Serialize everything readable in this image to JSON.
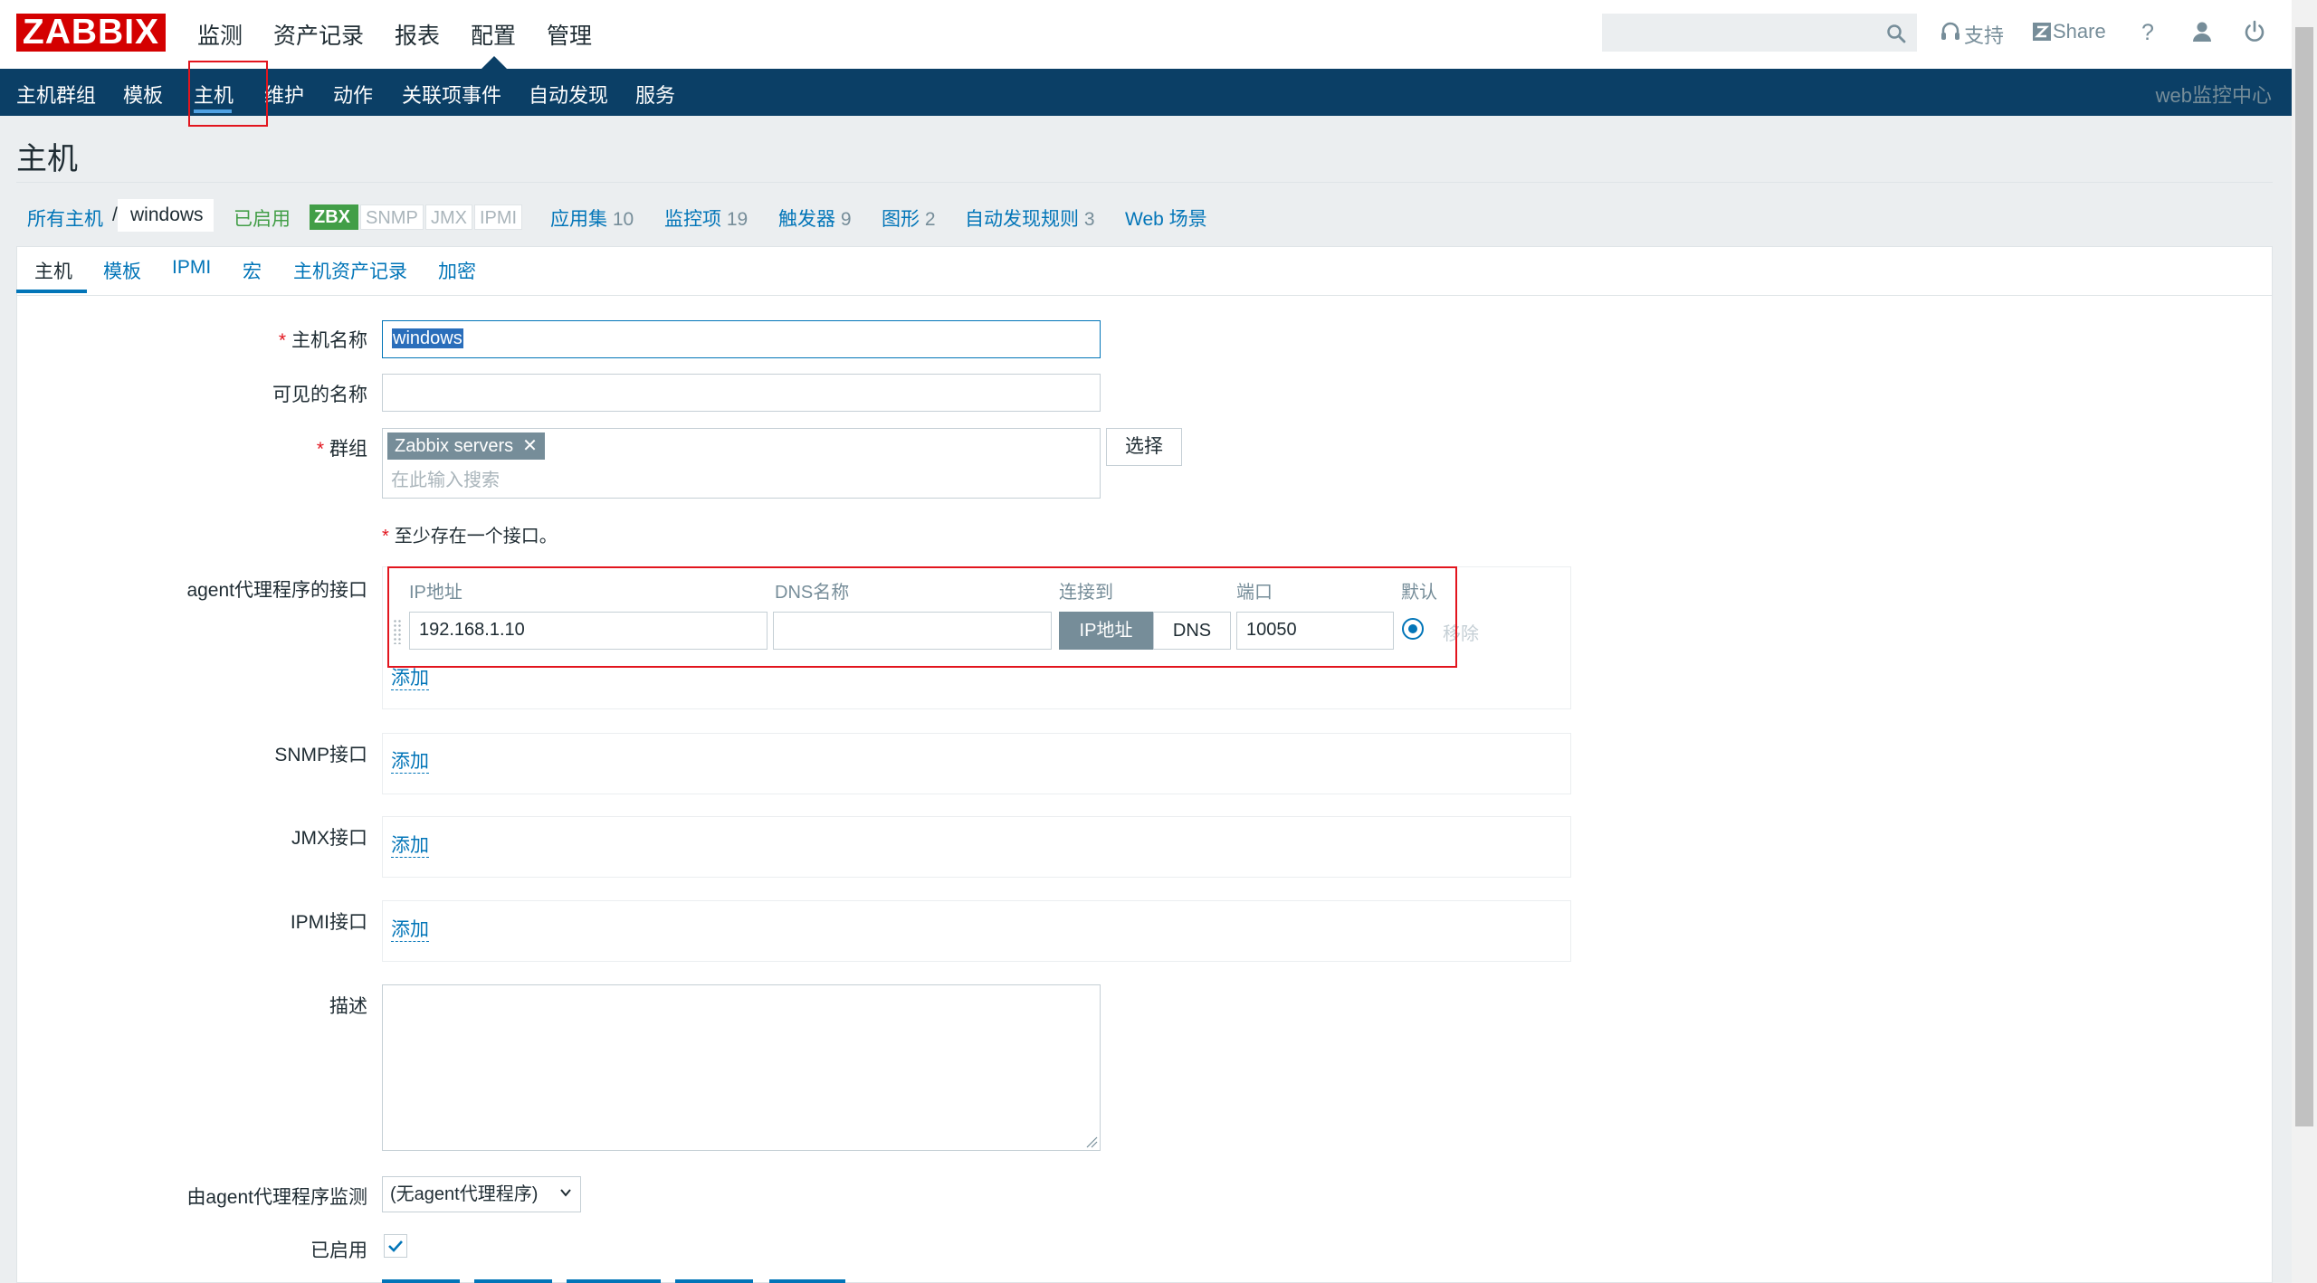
{
  "app": {
    "logo": "ZABBIX"
  },
  "main_nav": [
    "监测",
    "资产记录",
    "报表",
    "配置",
    "管理"
  ],
  "top_right": {
    "search_placeholder": "",
    "support": "支持",
    "share": "Share",
    "help": "?"
  },
  "sub_nav": {
    "items": [
      "主机群组",
      "模板",
      "主机",
      "维护",
      "动作",
      "关联项事件",
      "自动发现",
      "服务"
    ],
    "right": "web监控中心"
  },
  "page": {
    "title": "主机"
  },
  "breadcrumb": {
    "all_hosts": "所有主机",
    "sep": "/",
    "current": "windows",
    "enabled": "已启用",
    "availability": [
      "ZBX",
      "SNMP",
      "JMX",
      "IPMI"
    ],
    "links": [
      {
        "label": "应用集",
        "count": "10"
      },
      {
        "label": "监控项",
        "count": "19"
      },
      {
        "label": "触发器",
        "count": "9"
      },
      {
        "label": "图形",
        "count": "2"
      },
      {
        "label": "自动发现规则",
        "count": "3"
      },
      {
        "label": "Web 场景",
        "count": ""
      }
    ]
  },
  "tabs": [
    "主机",
    "模板",
    "IPMI",
    "宏",
    "主机资产记录",
    "加密"
  ],
  "form": {
    "host_name_label": "主机名称",
    "host_name_value": "windows",
    "visible_name_label": "可见的名称",
    "visible_name_value": "",
    "groups_label": "群组",
    "groups_chip": "Zabbix servers",
    "groups_placeholder": "在此输入搜索",
    "select_button": "选择",
    "interface_notice": "至少存在一个接口。",
    "agent_label": "agent代理程序的接口",
    "columns": {
      "ip": "IP地址",
      "dns": "DNS名称",
      "connect": "连接到",
      "port": "端口",
      "default": "默认"
    },
    "ip_value": "192.168.1.10",
    "dns_value": "",
    "connect_ip": "IP地址",
    "connect_dns": "DNS",
    "port_value": "10050",
    "remove": "移除",
    "add": "添加",
    "snmp_label": "SNMP接口",
    "jmx_label": "JMX接口",
    "ipmi_label": "IPMI接口",
    "description_label": "描述",
    "proxy_label": "由agent代理程序监测",
    "proxy_value": "(无agent代理程序)",
    "enabled_label": "已启用",
    "enabled_checked": true
  },
  "colors": {
    "brand": "#d40000",
    "nav": "#0b3f66",
    "link": "#0275b8",
    "green": "#429e47"
  }
}
